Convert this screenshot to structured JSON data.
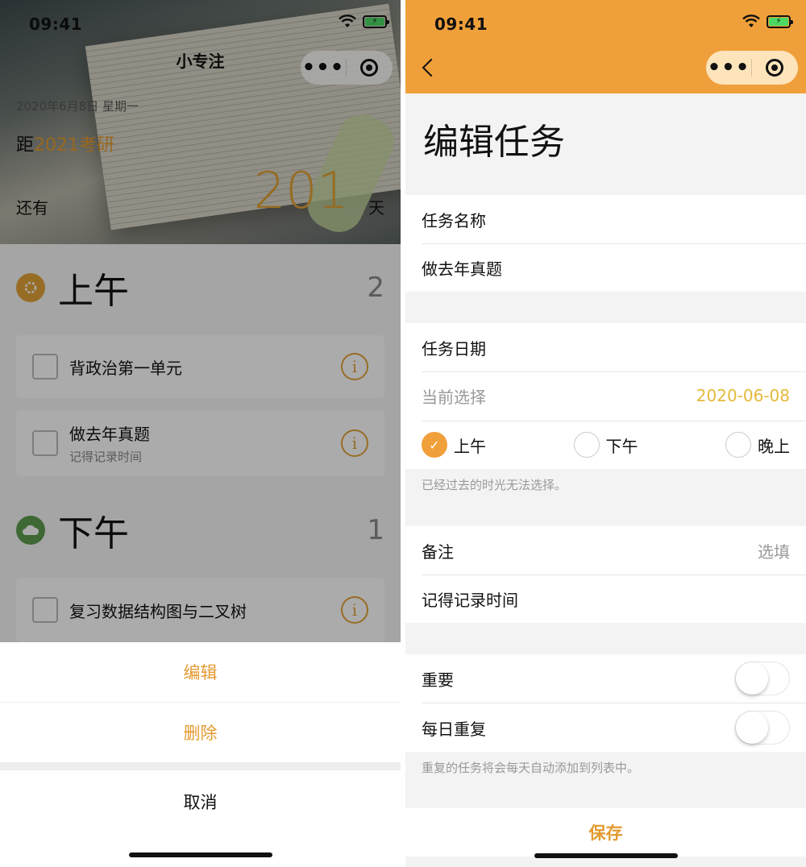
{
  "status_bar": {
    "time": "09:41"
  },
  "left": {
    "app_title": "小专注",
    "date_line": "2020年6月8日 星期一",
    "countdown_prefix": "距",
    "countdown_target": "2021考研",
    "remain_label": "还有",
    "days_value": "201",
    "days_unit": "天",
    "sections": [
      {
        "title": "上午",
        "count": "2",
        "tasks": [
          {
            "title": "背政治第一单元",
            "note": ""
          },
          {
            "title": "做去年真题",
            "note": "记得记录时间"
          }
        ]
      },
      {
        "title": "下午",
        "count": "1",
        "tasks": [
          {
            "title": "复习数据结构图与二叉树",
            "note": ""
          }
        ]
      }
    ],
    "action_sheet": {
      "edit": "编辑",
      "delete": "删除",
      "cancel": "取消"
    }
  },
  "right": {
    "page_title": "编辑任务",
    "task_name_label": "任务名称",
    "task_name_value": "做去年真题",
    "task_date_label": "任务日期",
    "current_selection_label": "当前选择",
    "current_selection_value": "2020-06-08",
    "periods": [
      {
        "label": "上午",
        "checked": true
      },
      {
        "label": "下午",
        "checked": false
      },
      {
        "label": "晚上",
        "checked": false
      }
    ],
    "period_hint": "已经过去的时光无法选择。",
    "note_label": "备注",
    "note_placeholder": "选填",
    "note_value": "记得记录时间",
    "important_label": "重要",
    "daily_repeat_label": "每日重复",
    "repeat_hint": "重复的任务将会每天自动添加到列表中。",
    "save_label": "保存"
  },
  "colors": {
    "accent": "#f0a03a",
    "accent_text": "#e39a2f",
    "date_highlight": "#e5b93b",
    "morning_icon": "#e1a33a",
    "afternoon_icon": "#5d9b4e"
  },
  "icons": [
    "wifi-icon",
    "battery-icon",
    "more-dots-icon",
    "target-icon",
    "sun-icon",
    "cloud-icon",
    "info-icon",
    "back-arrow-icon",
    "checkmark-icon"
  ]
}
